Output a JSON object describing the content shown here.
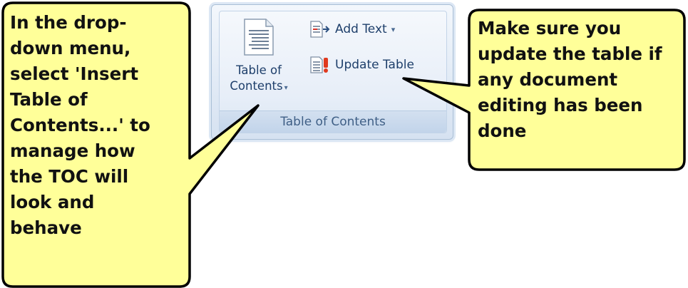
{
  "ribbon": {
    "group_caption": "Table of Contents",
    "toc_button_line1": "Table of",
    "toc_button_line2": "Contents",
    "add_text_label": "Add Text",
    "update_table_label": "Update Table",
    "dropdown_glyph": "▾"
  },
  "callouts": {
    "left": "In the drop-\ndown menu,\nselect 'Insert\nTable of\nContents...' to\nmanage how\nthe TOC will\nlook and\nbehave",
    "right": "Make sure you\nupdate the table if\nany document\nediting has been\ndone"
  },
  "colors": {
    "callout_fill": "#ffff99",
    "callout_stroke": "#000000",
    "ribbon_text": "#1e3f6b"
  },
  "icons": {
    "toc": "table-of-contents-icon",
    "add_text": "add-text-icon",
    "update_table": "update-table-icon"
  }
}
